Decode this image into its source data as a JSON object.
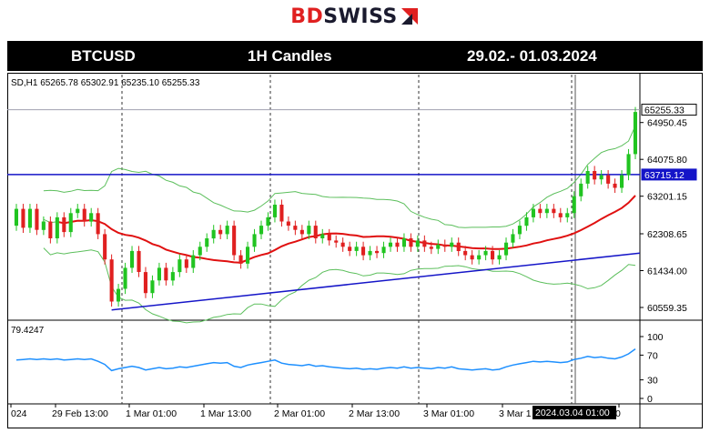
{
  "brand": {
    "part1": "BD",
    "part2": "SWISS"
  },
  "header": {
    "symbol": "BTCUSD",
    "timeframe": "1H Candles",
    "date_range": "29.02.- 01.03.2024"
  },
  "colors": {
    "bull": "#21c421",
    "bear": "#e02020",
    "ma": "#e01010",
    "trend": "#1515c8",
    "bands": "#5cbf5c",
    "rsi": "#1e90ff",
    "titlebar": "#000000"
  },
  "chart_data": {
    "type": "candlestick",
    "info_label": "SD,H1  65265.78 65302.91 65235.10 65255.33",
    "ylim": [
      60300,
      65700
    ],
    "y_ticks": [
      64950.45,
      64075.8,
      63201.15,
      62308.65,
      61434.0,
      60559.35
    ],
    "price_tags": {
      "last": 65255.33,
      "horizontal_level": 63715.12
    },
    "x_labels": [
      "024",
      "29 Feb 13:00",
      "1 Mar 01:00",
      "1 Mar 13:00",
      "2 Mar 01:00",
      "2 Mar 13:00",
      "3 Mar 01:00",
      "3 Mar 1",
      "0"
    ],
    "crosshair_label": "2024.03.04 01:00",
    "candles": [
      {
        "o": 62500,
        "c": 62900
      },
      {
        "o": 62900,
        "c": 62450
      },
      {
        "o": 62450,
        "c": 62900
      },
      {
        "o": 62900,
        "c": 62400
      },
      {
        "o": 62400,
        "c": 62600
      },
      {
        "o": 62600,
        "c": 62200
      },
      {
        "o": 62200,
        "c": 62700
      },
      {
        "o": 62700,
        "c": 62350
      },
      {
        "o": 62350,
        "c": 62800
      },
      {
        "o": 62800,
        "c": 62900
      },
      {
        "o": 62900,
        "c": 62600
      },
      {
        "o": 62600,
        "c": 62800
      },
      {
        "o": 62800,
        "c": 62300
      },
      {
        "o": 62300,
        "c": 61700
      },
      {
        "o": 61700,
        "c": 60700
      },
      {
        "o": 60700,
        "c": 61000
      },
      {
        "o": 61000,
        "c": 61500
      },
      {
        "o": 61500,
        "c": 61900
      },
      {
        "o": 61900,
        "c": 61400
      },
      {
        "o": 61400,
        "c": 60900
      },
      {
        "o": 60900,
        "c": 61200
      },
      {
        "o": 61200,
        "c": 61500
      },
      {
        "o": 61500,
        "c": 61200
      },
      {
        "o": 61200,
        "c": 61400
      },
      {
        "o": 61400,
        "c": 61700
      },
      {
        "o": 61700,
        "c": 61500
      },
      {
        "o": 61500,
        "c": 61800
      },
      {
        "o": 61800,
        "c": 62000
      },
      {
        "o": 62000,
        "c": 62200
      },
      {
        "o": 62200,
        "c": 62400
      },
      {
        "o": 62400,
        "c": 62300
      },
      {
        "o": 62300,
        "c": 62500
      },
      {
        "o": 62500,
        "c": 61800
      },
      {
        "o": 61800,
        "c": 61600
      },
      {
        "o": 61600,
        "c": 62000
      },
      {
        "o": 62000,
        "c": 62300
      },
      {
        "o": 62300,
        "c": 62500
      },
      {
        "o": 62500,
        "c": 62700
      },
      {
        "o": 62700,
        "c": 63000
      },
      {
        "o": 63000,
        "c": 62600
      },
      {
        "o": 62600,
        "c": 62500
      },
      {
        "o": 62500,
        "c": 62400
      },
      {
        "o": 62400,
        "c": 62300
      },
      {
        "o": 62300,
        "c": 62500
      },
      {
        "o": 62500,
        "c": 62200
      },
      {
        "o": 62200,
        "c": 62300
      },
      {
        "o": 62300,
        "c": 62150
      },
      {
        "o": 62150,
        "c": 62100
      },
      {
        "o": 62100,
        "c": 62000
      },
      {
        "o": 62000,
        "c": 61900
      },
      {
        "o": 61900,
        "c": 62000
      },
      {
        "o": 62000,
        "c": 61800
      },
      {
        "o": 61800,
        "c": 61900
      },
      {
        "o": 61900,
        "c": 61850
      },
      {
        "o": 61850,
        "c": 62000
      },
      {
        "o": 62000,
        "c": 62100
      },
      {
        "o": 62100,
        "c": 62000
      },
      {
        "o": 62000,
        "c": 62200
      },
      {
        "o": 62200,
        "c": 62000
      },
      {
        "o": 62000,
        "c": 62150
      },
      {
        "o": 62150,
        "c": 62000
      },
      {
        "o": 62000,
        "c": 61950
      },
      {
        "o": 61950,
        "c": 62050
      },
      {
        "o": 62050,
        "c": 62000
      },
      {
        "o": 62000,
        "c": 62100
      },
      {
        "o": 62100,
        "c": 61900
      },
      {
        "o": 61900,
        "c": 61800
      },
      {
        "o": 61800,
        "c": 61700
      },
      {
        "o": 61700,
        "c": 61800
      },
      {
        "o": 61800,
        "c": 61900
      },
      {
        "o": 61900,
        "c": 61700
      },
      {
        "o": 61700,
        "c": 61800
      },
      {
        "o": 61800,
        "c": 62100
      },
      {
        "o": 62100,
        "c": 62300
      },
      {
        "o": 62300,
        "c": 62500
      },
      {
        "o": 62500,
        "c": 62700
      },
      {
        "o": 62700,
        "c": 62900
      },
      {
        "o": 62900,
        "c": 62800
      },
      {
        "o": 62800,
        "c": 62900
      },
      {
        "o": 62900,
        "c": 62800
      },
      {
        "o": 62800,
        "c": 62700
      },
      {
        "o": 62700,
        "c": 62800
      },
      {
        "o": 62800,
        "c": 63200
      },
      {
        "o": 63200,
        "c": 63500
      },
      {
        "o": 63500,
        "c": 63800
      },
      {
        "o": 63800,
        "c": 63600
      },
      {
        "o": 63600,
        "c": 63700
      },
      {
        "o": 63700,
        "c": 63500
      },
      {
        "o": 63500,
        "c": 63400
      },
      {
        "o": 63400,
        "c": 63700
      },
      {
        "o": 63700,
        "c": 64200
      },
      {
        "o": 64200,
        "c": 65200
      }
    ],
    "rsi": {
      "label": "79.4247",
      "ylim": [
        0,
        100
      ],
      "ticks": [
        100,
        70,
        30,
        0
      ],
      "values": [
        62,
        63,
        64,
        63,
        64,
        63,
        64,
        62,
        63,
        64,
        63,
        64,
        60,
        55,
        45,
        48,
        50,
        52,
        50,
        46,
        48,
        50,
        48,
        49,
        51,
        50,
        52,
        54,
        56,
        58,
        57,
        58,
        52,
        50,
        54,
        56,
        58,
        60,
        62,
        57,
        55,
        54,
        53,
        55,
        52,
        53,
        51,
        50,
        49,
        48,
        49,
        47,
        48,
        47,
        49,
        50,
        49,
        51,
        49,
        50,
        49,
        48,
        50,
        49,
        51,
        48,
        47,
        46,
        47,
        48,
        46,
        47,
        51,
        54,
        56,
        58,
        60,
        59,
        60,
        59,
        58,
        59,
        63,
        65,
        68,
        66,
        67,
        65,
        64,
        67,
        72,
        80
      ]
    }
  }
}
